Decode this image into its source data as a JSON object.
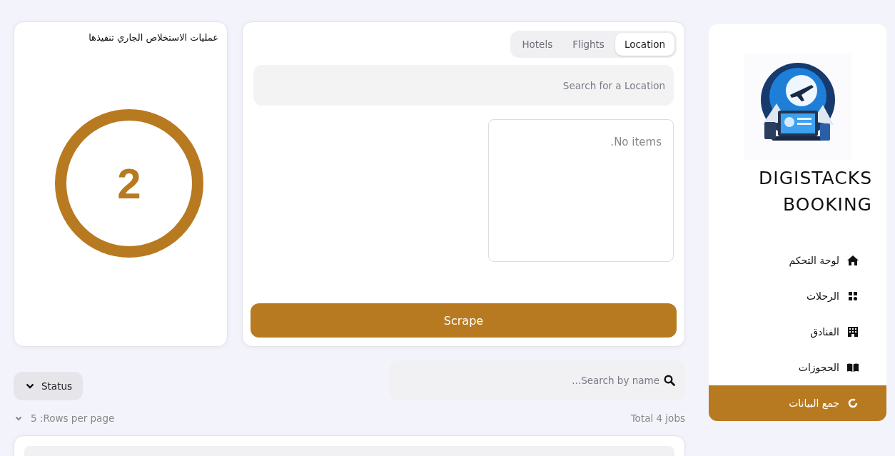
{
  "counter_card": {
    "title": "عمليات الاستخلاص الجاري تنفيذها",
    "count": "2"
  },
  "scraper": {
    "tabs": [
      {
        "label": "Location",
        "selected": true
      },
      {
        "label": "Flights",
        "selected": false
      },
      {
        "label": "Hotels",
        "selected": false
      }
    ],
    "search": {
      "placeholder": "Search for a Location"
    },
    "list_empty_text": ".No items",
    "button": "Scrape"
  },
  "jobs": {
    "search": {
      "placeholder": "...Search by name"
    },
    "status_filter": "Status",
    "rows_per_page": "5 :Rows per page",
    "total": "Total 4 jobs"
  },
  "sidebar": {
    "brand": [
      "DIGISTACKS",
      "BOOKING"
    ],
    "items": [
      {
        "label": "لوحة التحكم",
        "selected": false
      },
      {
        "label": "الرحلات",
        "selected": false
      },
      {
        "label": "الفنادق",
        "selected": false
      },
      {
        "label": "الحجوزات",
        "selected": false
      },
      {
        "label": "جمع البيانات",
        "selected": true
      }
    ]
  }
}
